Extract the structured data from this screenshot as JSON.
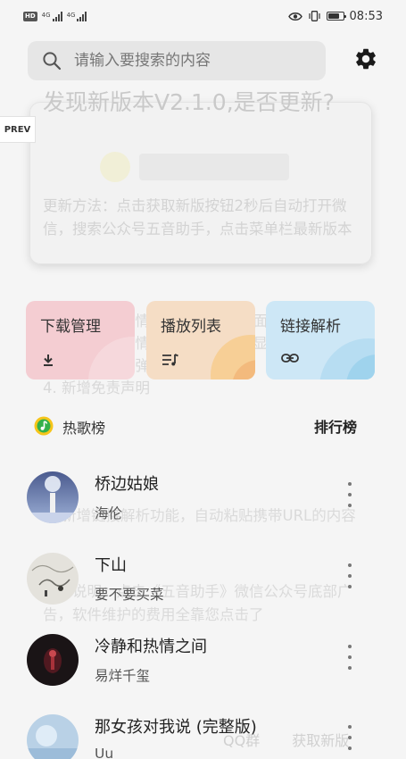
{
  "status_bar": {
    "hd_badge": "HD",
    "sig1_label": "4G",
    "sig2_label": "4G",
    "time": "08:53",
    "battery_level": 0.75
  },
  "search": {
    "placeholder": "请输入要搜索的内容",
    "value": ""
  },
  "icons": {
    "search": "search-icon",
    "settings": "gear-icon",
    "download": "download-icon",
    "playlist": "playlist-icon",
    "link": "link-icon",
    "more": "more-vertical-icon"
  },
  "prev_tag": "PREV",
  "update_dialog": {
    "title": "发现新版本V2.1.0,是否更新?",
    "body": "更新方法：点击获取新版按钮2秒后自动打开微信，搜索公众号五音助手，点击菜单栏最新版本",
    "list_a": "1. 新增播放详情页面、支持全页面显示歌",
    "list_b": "2. 新增播放详情页面，支持歌词显示",
    "list_c": "3. 优化图标、弹窗UI",
    "list_d": "4. 新增免责声明",
    "list_e": "5. 新增链接解析功能，自动粘贴携带URL的内容",
    "list_f": "维护说明：点击《五音助手》微信公众号底部广告，软件维护的费用全靠您点击了",
    "btn_qq": "QQ群",
    "btn_get": "获取新版"
  },
  "cards": [
    {
      "label": "下载管理",
      "icon": "download-icon",
      "color": "#f4cdd2"
    },
    {
      "label": "播放列表",
      "icon": "playlist-icon",
      "color": "#f5ddc5"
    },
    {
      "label": "链接解析",
      "icon": "link-icon",
      "color": "#cde7f6"
    }
  ],
  "chart_section": {
    "title": "热歌榜",
    "link": "排行榜"
  },
  "songs": [
    {
      "title": "桥边姑娘",
      "artist": "海伦"
    },
    {
      "title": "下山",
      "artist": "要不要买菜"
    },
    {
      "title": "冷静和热情之间",
      "artist": "易烊千玺"
    },
    {
      "title": "那女孩对我说 (完整版)",
      "artist": "Uu"
    }
  ]
}
